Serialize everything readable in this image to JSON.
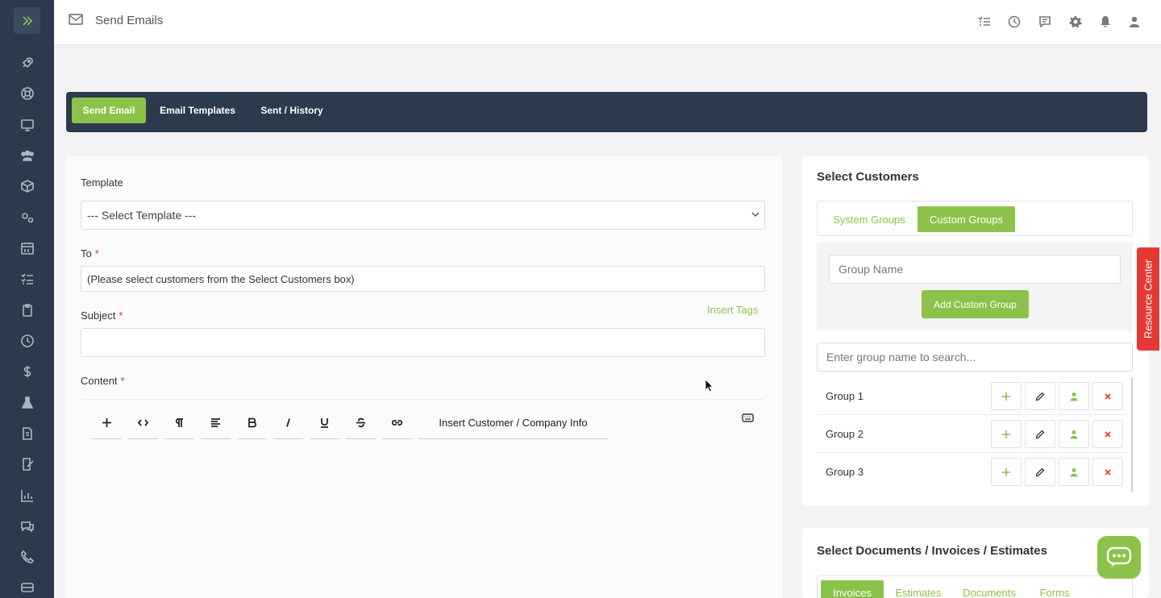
{
  "header": {
    "title": "Send Emails"
  },
  "tabs": [
    {
      "label": "Send Email",
      "active": true
    },
    {
      "label": "Email Templates",
      "active": false
    },
    {
      "label": "Sent / History",
      "active": false
    }
  ],
  "form": {
    "template_label": "Template",
    "template_value": "--- Select Template ---",
    "to_label": "To",
    "to_value": "(Please select customers from the Select Customers box)",
    "subject_label": "Subject",
    "insert_tags": "Insert Tags",
    "content_label": "Content",
    "required_mark": "*"
  },
  "editor_toolbar": {
    "insert_info": "Insert Customer / Company Info",
    "buttons": [
      "plus-icon",
      "code-icon",
      "paragraph-icon",
      "align-icon",
      "bold-icon",
      "italic-icon",
      "underline-icon",
      "strikethrough-icon",
      "link-icon"
    ]
  },
  "customers": {
    "title": "Select Customers",
    "tabs": [
      "System Groups",
      "Custom Groups"
    ],
    "active_tab": "Custom Groups",
    "group_name_placeholder": "Group Name",
    "add_button": "Add Custom Group",
    "search_placeholder": "Enter group name to search...",
    "groups": [
      "Group 1",
      "Group 2",
      "Group 3"
    ]
  },
  "resource_center": "Resource Center",
  "documents": {
    "title": "Select Documents / Invoices / Estimates",
    "tabs": [
      "Invoices",
      "Estimates",
      "Documents",
      "Forms"
    ]
  },
  "colors": {
    "accent": "#8bc34a",
    "nav": "#2d3a4e",
    "danger": "#e53935"
  }
}
